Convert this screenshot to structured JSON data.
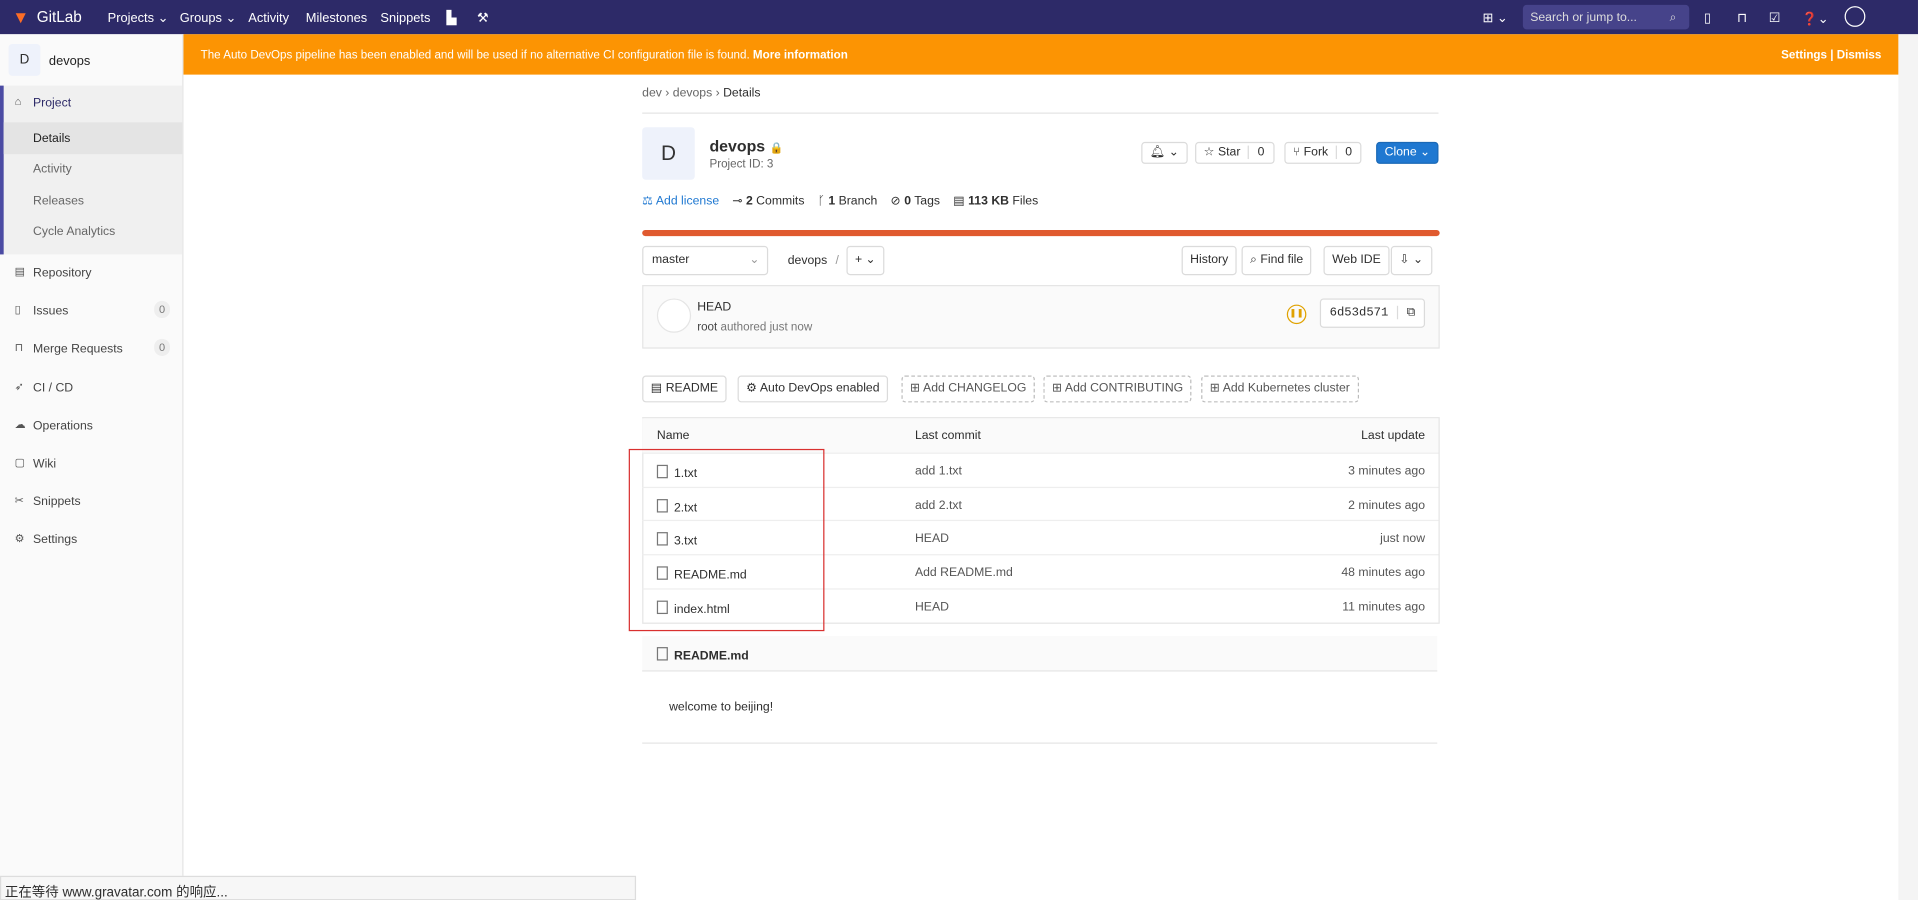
{
  "nav": {
    "brand": "GitLab",
    "links": [
      "Projects",
      "Groups",
      "Activity",
      "Milestones",
      "Snippets"
    ],
    "search_placeholder": "Search or jump to...",
    "bg": "#2d2a68"
  },
  "banner": {
    "text": "The Auto DevOps pipeline has been enabled and will be used if no alternative CI configuration file is found.",
    "link": "More information",
    "settings": "Settings",
    "sep": "|",
    "dismiss": "Dismiss",
    "bg": "#fc9403"
  },
  "sidebar": {
    "avatar": "D",
    "project": "devops",
    "section": "Project",
    "sub": [
      "Details",
      "Activity",
      "Releases",
      "Cycle Analytics"
    ],
    "items": [
      {
        "label": "Repository",
        "icon": "doc"
      },
      {
        "label": "Issues",
        "icon": "issues",
        "badge": "0"
      },
      {
        "label": "Merge Requests",
        "icon": "merge",
        "badge": "0"
      },
      {
        "label": "CI / CD",
        "icon": "rocket"
      },
      {
        "label": "Operations",
        "icon": "cloud"
      },
      {
        "label": "Wiki",
        "icon": "book"
      },
      {
        "label": "Snippets",
        "icon": "scissors"
      },
      {
        "label": "Settings",
        "icon": "gear"
      }
    ]
  },
  "breadcrumb": [
    "dev",
    "devops",
    "Details"
  ],
  "project": {
    "avatar": "D",
    "name": "devops",
    "id": "Project ID: 3",
    "star": "Star",
    "star_count": "0",
    "fork": "Fork",
    "fork_count": "0",
    "clone": "Clone"
  },
  "stats": {
    "license": "Add license",
    "commits_n": "2",
    "commits": "Commits",
    "branch_n": "1",
    "branch": "Branch",
    "tags_n": "0",
    "tags": "Tags",
    "files_n": "113 KB",
    "files": "Files"
  },
  "repo": {
    "branch": "master",
    "path": "devops",
    "sep": "/",
    "history": "History",
    "find": "Find file",
    "webide": "Web IDE"
  },
  "commit": {
    "title": "HEAD",
    "author": "root",
    "meta": "authored just now",
    "sha": "6d53d571"
  },
  "actions": [
    "README",
    "Auto DevOps enabled",
    "Add CHANGELOG",
    "Add CONTRIBUTING",
    "Add Kubernetes cluster"
  ],
  "table": {
    "headers": [
      "Name",
      "Last commit",
      "Last update"
    ],
    "rows": [
      [
        "1.txt",
        "add 1.txt",
        "3 minutes ago"
      ],
      [
        "2.txt",
        "add 2.txt",
        "2 minutes ago"
      ],
      [
        "3.txt",
        "HEAD",
        "just now"
      ],
      [
        "README.md",
        "Add README.md",
        "48 minutes ago"
      ],
      [
        "index.html",
        "HEAD",
        "11 minutes ago"
      ]
    ]
  },
  "readme": {
    "title": "README.md",
    "content": "welcome to beijing!"
  },
  "status": "正在等待 www.gravatar.com 的响应..."
}
